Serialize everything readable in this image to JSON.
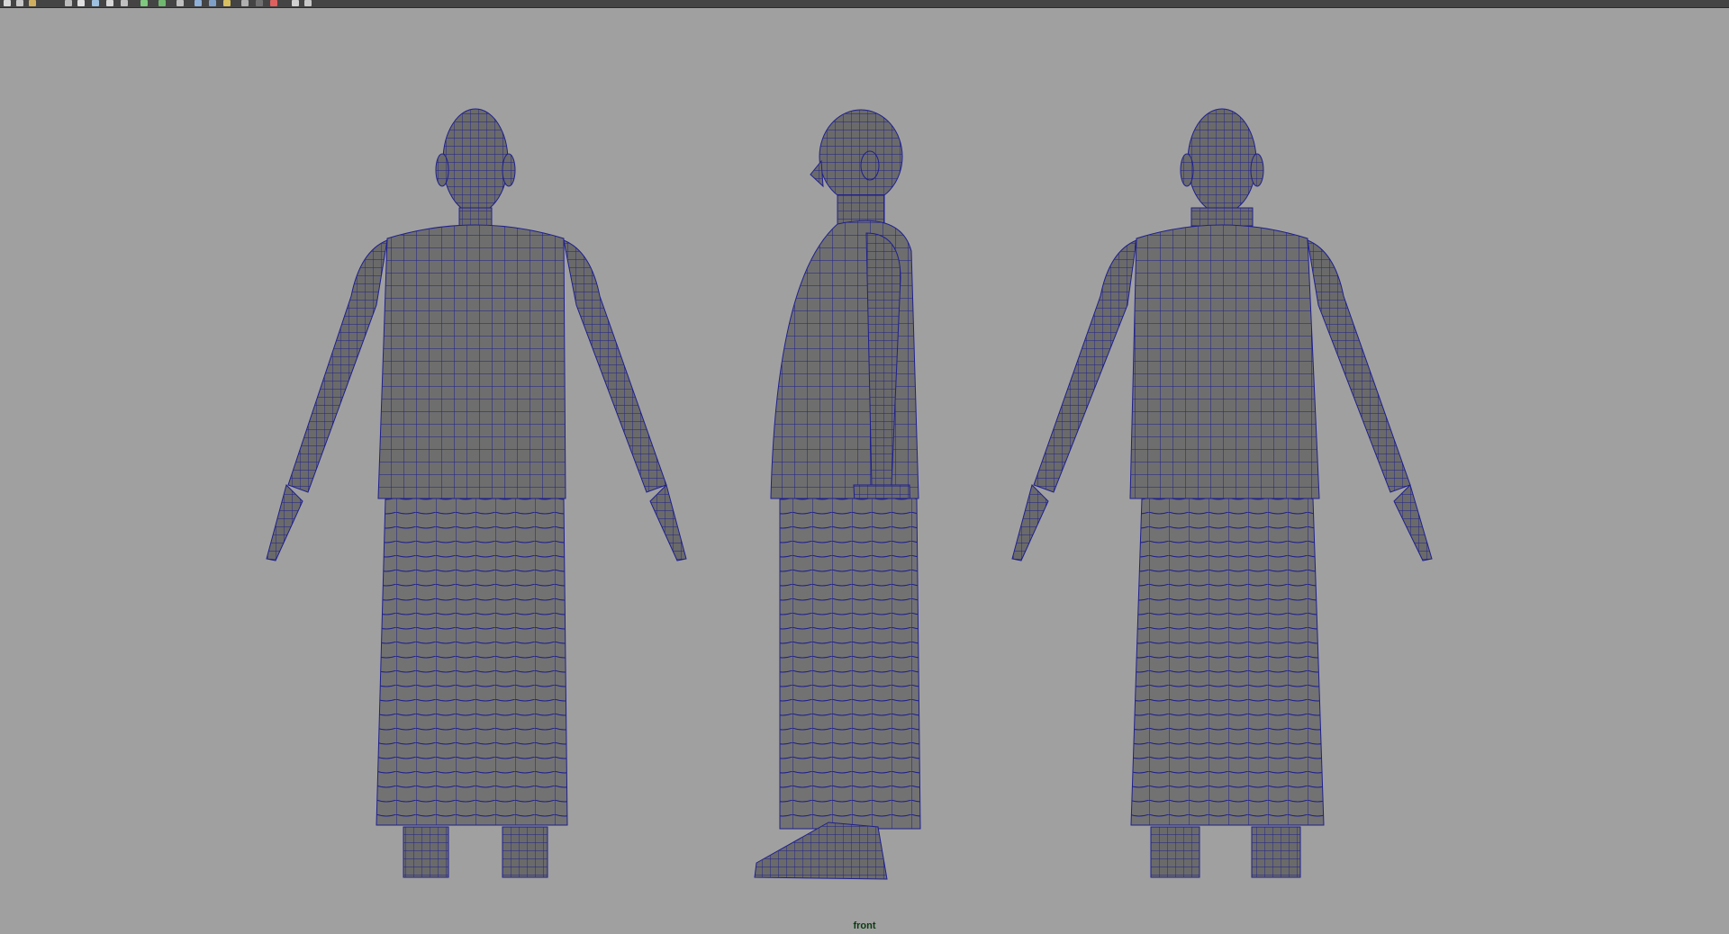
{
  "toolbar": {
    "icons": [
      {
        "name": "select-tool-icon",
        "color": "#d8d8d8"
      },
      {
        "name": "lasso-tool-icon",
        "color": "#c8c8c8"
      },
      {
        "name": "paint-select-icon",
        "color": "#d0b060"
      },
      {
        "name": "snap-grid-icon",
        "color": "#bcbcbc"
      },
      {
        "name": "snap-curve-icon",
        "color": "#e0e0e0"
      },
      {
        "name": "snap-point-icon",
        "color": "#9ec0e0"
      },
      {
        "name": "snap-view-icon",
        "color": "#d8d8d8"
      },
      {
        "name": "snap-surface-icon",
        "color": "#c0c0c0"
      },
      {
        "name": "history-icon",
        "color": "#7fc87f"
      },
      {
        "name": "construction-icon",
        "color": "#6fb86f"
      },
      {
        "name": "render-frame-icon",
        "color": "#c0c0c0"
      },
      {
        "name": "ipr-render-icon",
        "color": "#8fb0d8"
      },
      {
        "name": "render-settings-icon",
        "color": "#7fa0c8"
      },
      {
        "name": "hypershade-icon",
        "color": "#d8c060"
      },
      {
        "name": "light-icon",
        "color": "#b0b0b0"
      },
      {
        "name": "sphere-icon",
        "color": "#707070"
      },
      {
        "name": "paint-icon",
        "color": "#e06060"
      },
      {
        "name": "outliner-icon",
        "color": "#d0d0d0"
      },
      {
        "name": "attribute-icon",
        "color": "#c8c8c8"
      }
    ]
  },
  "viewport": {
    "camera_label": "front",
    "background_color": "#a0a0a0",
    "mesh_fill_color": "#6e6e6e",
    "wire_color": "#1f1f8f"
  }
}
